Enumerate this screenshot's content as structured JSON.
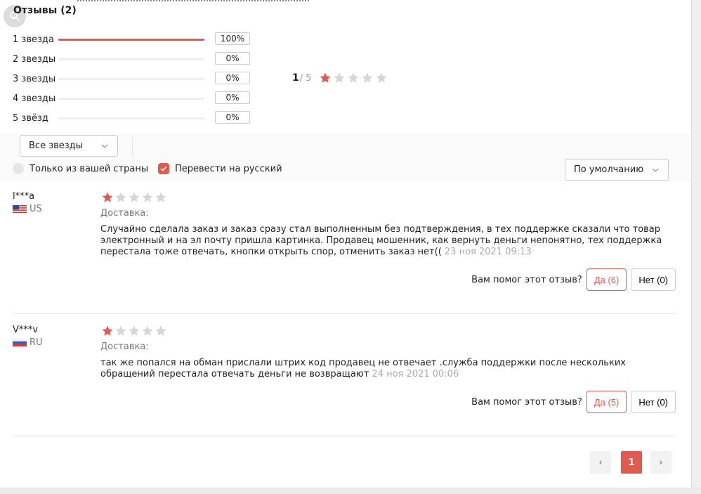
{
  "header": {
    "title": "Отзывы (2)"
  },
  "histogram": [
    {
      "label": "1 звезда",
      "percent_text": "100%",
      "fill": 1.0
    },
    {
      "label": "2 звезды",
      "percent_text": "0%",
      "fill": 0
    },
    {
      "label": "3 звезды",
      "percent_text": "0%",
      "fill": 0
    },
    {
      "label": "4 звезды",
      "percent_text": "0%",
      "fill": 0
    },
    {
      "label": "5 звёзд",
      "percent_text": "0%",
      "fill": 0
    }
  ],
  "summary": {
    "score": "1",
    "max": "/ 5",
    "stars_filled": 1,
    "stars_total": 5
  },
  "filters": {
    "stars_select": "Все звезды",
    "only_country": "Только из вашей страны",
    "translate": "Перевести на русский",
    "sort_select": "По умолчанию"
  },
  "reviews": [
    {
      "user": "l***a",
      "country": "US",
      "flag": "us-flag-icon",
      "stars_filled": 1,
      "delivery_label": "Доставка:",
      "text": "Случайно сделала заказ и заказ сразу стал выполненным без подтверждения, в тех поддержке сказали что товар электронный и на эл почту пришла картинка. Продавец мошенник, как вернуть деньги непонятно, тех поддержка перестала тоже отвечать, кнопки открыть спор, отменить заказ нет((",
      "date": "23 ноя 2021 09:13",
      "helpful_question": "Вам помог этот отзыв?",
      "yes_label": "Да (6)",
      "no_label": "Нет (0)"
    },
    {
      "user": "V***v",
      "country": "RU",
      "flag": "ru-flag-icon",
      "stars_filled": 1,
      "delivery_label": "Доставка:",
      "text": "так же попался на обман прислали штрих код продавец не отвечает .служба поддержки после нескольких обращений перестала отвечать деньги не возвращают",
      "date": "24 ноя 2021 00:06",
      "helpful_question": "Вам помог этот отзыв?",
      "yes_label": "Да (5)",
      "no_label": "Нет (0)"
    }
  ],
  "pagination": {
    "prev": "‹",
    "current": "1",
    "next": "›"
  },
  "colors": {
    "accent": "#e05a4f",
    "star_empty": "#d6d6d6",
    "muted": "#aaaaaa"
  }
}
